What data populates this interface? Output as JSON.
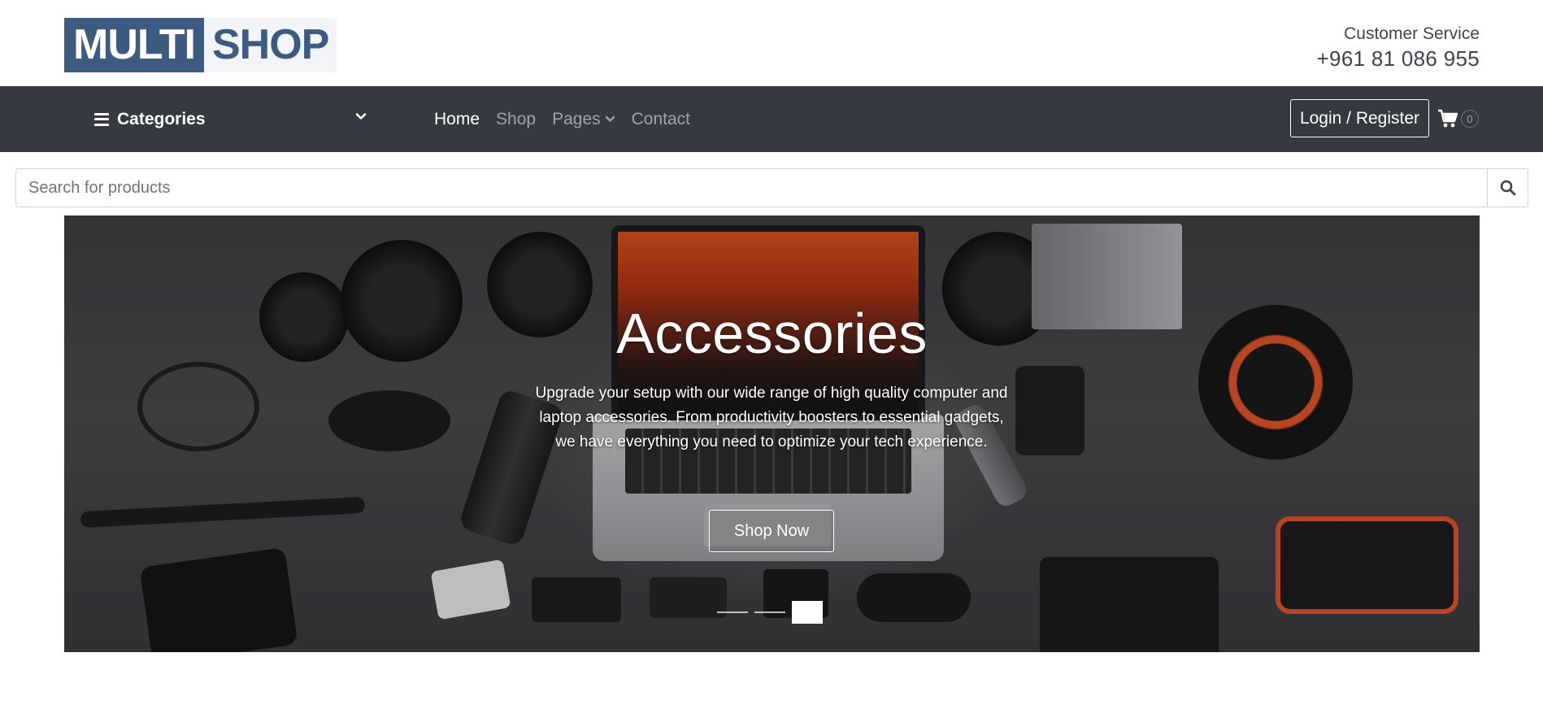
{
  "logo": {
    "part1": "MULTI",
    "part2": "SHOP"
  },
  "customer_service": {
    "label": "Customer Service",
    "phone": "+961 81 086 955"
  },
  "nav": {
    "categories_label": "Categories",
    "links": [
      {
        "label": "Home",
        "active": true
      },
      {
        "label": "Shop",
        "active": false
      },
      {
        "label": "Pages",
        "active": false,
        "dropdown": true
      },
      {
        "label": "Contact",
        "active": false
      }
    ],
    "login_label": "Login / Register",
    "cart_count": "0"
  },
  "search": {
    "placeholder": "Search for products",
    "value": ""
  },
  "hero": {
    "title": "Accessories",
    "text": "Upgrade your setup with our wide range of high quality computer and laptop accessories. From productivity boosters to essential gadgets, we have everything you need to optimize your tech experience.",
    "button_label": "Shop Now",
    "slides_total": 3,
    "active_slide": 3
  },
  "colors": {
    "brand": "#3d5a80",
    "navbar": "#343a40",
    "accent_orange": "#e0552a"
  },
  "icons": [
    "bars-icon",
    "chevron-down-icon",
    "shopping-cart-icon",
    "search-icon"
  ]
}
